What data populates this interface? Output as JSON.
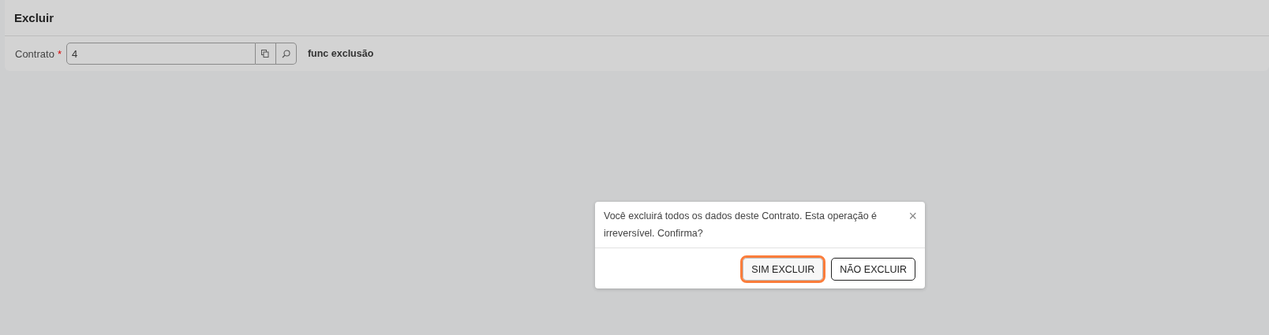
{
  "panel": {
    "title": "Excluir"
  },
  "field": {
    "label": "Contrato",
    "required_mark": "*",
    "value": "4",
    "description": "func exclusão"
  },
  "dialog": {
    "message": "Você excluirá todos os dados deste Contrato. Esta operação é irreversível. Confirma?",
    "close": "×",
    "buttons": [
      {
        "label": "SIM EXCLUIR",
        "focused": true
      },
      {
        "label": "NÃO EXCLUIR",
        "focused": false
      }
    ]
  }
}
